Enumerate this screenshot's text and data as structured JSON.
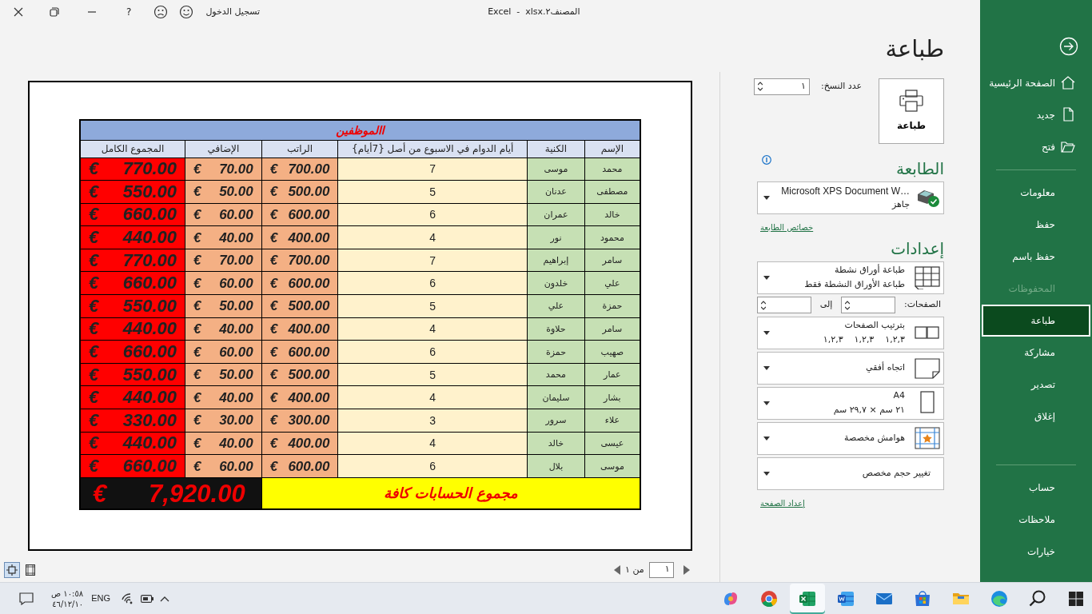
{
  "window": {
    "title": "Excel  -  xlsx.المصنف٢",
    "sign_in": "تسجيل الدخول",
    "help": "?"
  },
  "sidebar": {
    "sections": [
      {
        "items": [
          {
            "label": "الصفحة الرئيسية",
            "kind": "home",
            "selected": false,
            "disabled": false
          },
          {
            "label": "جديد",
            "kind": "new",
            "selected": false,
            "disabled": false
          },
          {
            "label": "فتح",
            "kind": "open",
            "selected": false,
            "disabled": false
          }
        ]
      },
      {
        "items": [
          {
            "label": "معلومات",
            "selected": false,
            "disabled": false
          },
          {
            "label": "حفظ",
            "selected": false,
            "disabled": false
          },
          {
            "label": "حفظ باسم",
            "selected": false,
            "disabled": false
          },
          {
            "label": "المحفوظات",
            "selected": false,
            "disabled": true
          },
          {
            "label": "طباعة",
            "selected": true,
            "disabled": false
          },
          {
            "label": "مشاركة",
            "selected": false,
            "disabled": false
          },
          {
            "label": "تصدير",
            "selected": false,
            "disabled": false
          },
          {
            "label": "إغلاق",
            "selected": false,
            "disabled": false
          }
        ]
      },
      {
        "items": [
          {
            "label": "حساب",
            "selected": false,
            "disabled": false
          },
          {
            "label": "ملاحظات",
            "selected": false,
            "disabled": false
          },
          {
            "label": "خيارات",
            "selected": false,
            "disabled": false
          }
        ]
      }
    ]
  },
  "print": {
    "heading": "طباعة",
    "print_button": "طباعة",
    "copies_label": "عدد النسخ:",
    "copies_value": "١",
    "printer_heading": "الطابعة",
    "printer": {
      "name": "Microsoft XPS Document W…",
      "status": "جاهز"
    },
    "printer_properties_link": "خصائص الطابعة",
    "settings_heading": "إعدادات",
    "settings": [
      {
        "kind": "sheets",
        "title": "طباعة أوراق نشطة",
        "subtitle": "طباعة الأوراق النشطة فقط"
      },
      {
        "kind": "range",
        "label": "الصفحات:",
        "to_label": "إلى"
      },
      {
        "kind": "collate",
        "title": "بترتيب الصفحات",
        "subtitle": "١,٢,٣    ١,٢,٣    ١,٢,٣"
      },
      {
        "kind": "orientation",
        "title": "اتجاه أفقي"
      },
      {
        "kind": "paper",
        "title": "A4",
        "subtitle": "٢١ سم × ٢٩,٧ سم"
      },
      {
        "kind": "margins",
        "title": "هوامش مخصصة"
      },
      {
        "kind": "scaling",
        "title": "تغيير حجم مخصص"
      }
    ],
    "page_setup_link": "إعداد الصفحة"
  },
  "sheet": {
    "title": "االموظفين",
    "columns": [
      "الإسم",
      "الكنية",
      "أيام الدوام في الاسبوع  من أصل {7أيام}",
      "الراتب",
      "الإضافي",
      "المجموع الكامل"
    ],
    "rows": [
      [
        "محمد",
        "موسى",
        "7",
        "€ 700.00",
        "€ 70.00",
        "€ 770.00"
      ],
      [
        "مصطفى",
        "عدنان",
        "5",
        "€ 500.00",
        "€ 50.00",
        "€ 550.00"
      ],
      [
        "خالد",
        "عمران",
        "6",
        "€ 600.00",
        "€ 60.00",
        "€ 660.00"
      ],
      [
        "محمود",
        "نور",
        "4",
        "€ 400.00",
        "€ 40.00",
        "€ 440.00"
      ],
      [
        "سامر",
        "إبراهيم",
        "7",
        "€ 700.00",
        "€ 70.00",
        "€ 770.00"
      ],
      [
        "علي",
        "خلدون",
        "6",
        "€ 600.00",
        "€ 60.00",
        "€ 660.00"
      ],
      [
        "حمزة",
        "علي",
        "5",
        "€ 500.00",
        "€ 50.00",
        "€ 550.00"
      ],
      [
        "سامر",
        "حلاوة",
        "4",
        "€ 400.00",
        "€ 40.00",
        "€ 440.00"
      ],
      [
        "صهيب",
        "حمزة",
        "6",
        "€ 600.00",
        "€ 60.00",
        "€ 660.00"
      ],
      [
        "عمار",
        "محمد",
        "5",
        "€ 500.00",
        "€ 50.00",
        "€ 550.00"
      ],
      [
        "بشار",
        "سليمان",
        "4",
        "€ 400.00",
        "€ 40.00",
        "€ 440.00"
      ],
      [
        "علاء",
        "سرور",
        "3",
        "€ 300.00",
        "€ 30.00",
        "€ 330.00"
      ],
      [
        "عيسى",
        "خالد",
        "4",
        "€ 400.00",
        "€ 40.00",
        "€ 440.00"
      ],
      [
        "موسى",
        "بلال",
        "6",
        "€ 600.00",
        "€ 60.00",
        "€ 660.00"
      ]
    ],
    "total_label": "مجموع الحسابات كافة",
    "total_value": "€ 7,920.00"
  },
  "preview": {
    "view_buttons": [
      {
        "kind": "fit",
        "selected": true
      },
      {
        "kind": "margins",
        "selected": false
      }
    ],
    "page_value": "١",
    "of_label": "من ١"
  },
  "taskbar": {
    "time": "١٠:٥٨ ص",
    "date": "٤٦/١٢/١٠",
    "language": "ENG",
    "apps": [
      {
        "kind": "copilot",
        "selected": false
      },
      {
        "kind": "chrome",
        "selected": false
      },
      {
        "kind": "excel",
        "selected": true
      },
      {
        "kind": "word",
        "selected": false
      },
      {
        "kind": "mail",
        "selected": false
      },
      {
        "kind": "store",
        "selected": false
      },
      {
        "kind": "folder",
        "selected": false
      },
      {
        "kind": "edge",
        "selected": false
      },
      {
        "kind": "search",
        "selected": false
      },
      {
        "kind": "windows",
        "selected": false
      }
    ]
  }
}
